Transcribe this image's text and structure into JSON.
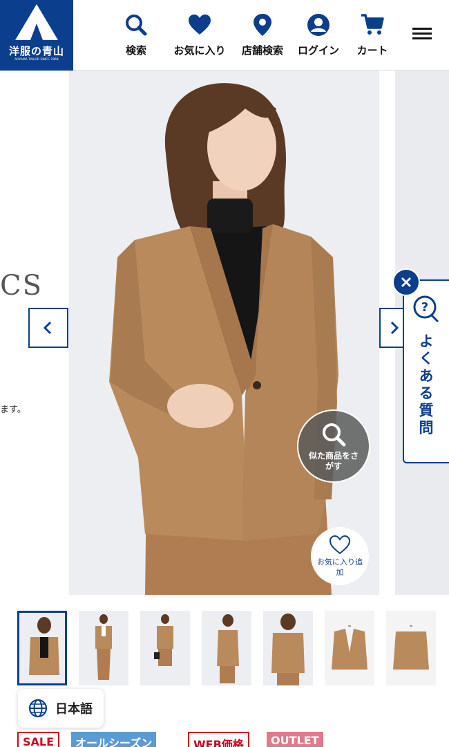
{
  "header": {
    "logo_text": "洋服の青山",
    "logo_sub": "AOYAMA TAILOR SINCE 1964",
    "nav": [
      {
        "label": "検索",
        "icon": "search-icon"
      },
      {
        "label": "お気に入り",
        "icon": "heart-icon"
      },
      {
        "label": "店舗検索",
        "icon": "map-pin-icon"
      },
      {
        "label": "ログイン",
        "icon": "user-icon"
      },
      {
        "label": "カート",
        "icon": "cart-icon"
      }
    ],
    "menu_icon": "hamburger-icon"
  },
  "carousel": {
    "prev_slide_text": "CS",
    "prev_slide_note": "ます。",
    "prev_icon": "chevron-left-icon",
    "next_icon": "chevron-right-icon",
    "similar_label": "似た商品をさがす",
    "favorite_label": "お気に入り追加"
  },
  "faq": {
    "label": "よくある質問",
    "close_icon": "close-icon"
  },
  "thumbnails": [
    {
      "alt": "front-skirt",
      "active": true
    },
    {
      "alt": "front-pants-white"
    },
    {
      "alt": "full-skirt-bag"
    },
    {
      "alt": "side"
    },
    {
      "alt": "back"
    },
    {
      "alt": "jacket-front"
    },
    {
      "alt": "jacket-back"
    }
  ],
  "language": {
    "label": "日本語"
  },
  "tags": [
    {
      "label": "SALE",
      "color": "#d0021b"
    },
    {
      "label": "オールシーズン",
      "color": "#5b9bd5"
    },
    {
      "label": "WEB価格",
      "color": "#d0021b"
    },
    {
      "label": "OUTLET",
      "color": "#e07a8a"
    }
  ],
  "colors": {
    "brand": "#0b3e8c",
    "camel": "#b8875a"
  }
}
